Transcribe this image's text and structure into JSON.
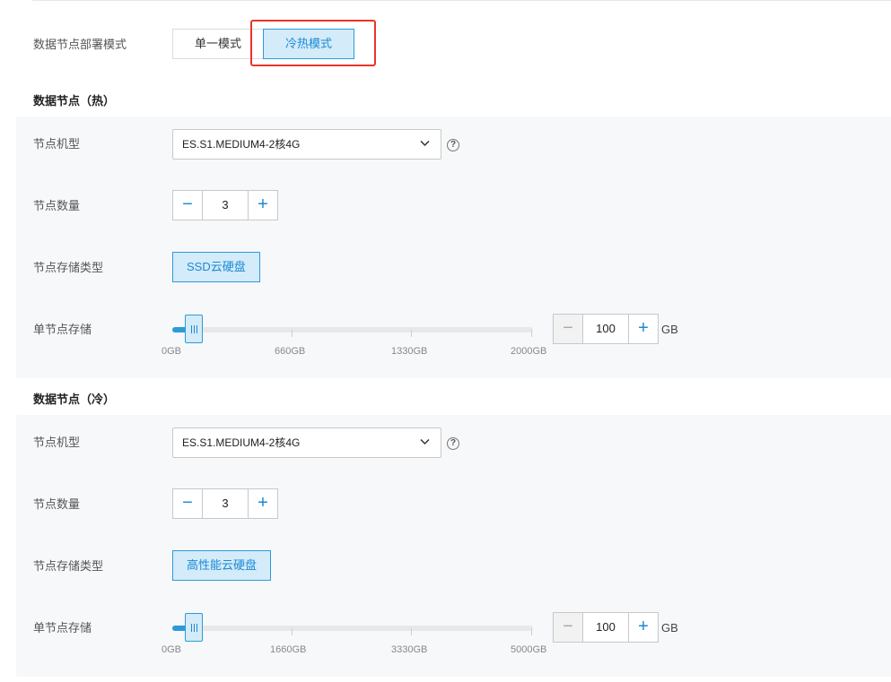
{
  "deploy_mode": {
    "label": "数据节点部署模式",
    "options": [
      "单一模式",
      "冷热模式"
    ],
    "selected": "冷热模式"
  },
  "hot": {
    "title": "数据节点（热）",
    "model_label": "节点机型",
    "model_value": "ES.S1.MEDIUM4-2核4G",
    "count_label": "节点数量",
    "count_value": "3",
    "storage_type_label": "节点存储类型",
    "storage_type_value": "SSD云硬盘",
    "storage_label": "单节点存储",
    "storage_value": "100",
    "storage_unit": "GB",
    "slider_min": 0,
    "slider_max": 2000,
    "slider_value": 20,
    "ticks": [
      "0GB",
      "660GB",
      "1330GB",
      "2000GB"
    ]
  },
  "cold": {
    "title": "数据节点（冷）",
    "model_label": "节点机型",
    "model_value": "ES.S1.MEDIUM4-2核4G",
    "count_label": "节点数量",
    "count_value": "3",
    "storage_type_label": "节点存储类型",
    "storage_type_value": "高性能云硬盘",
    "storage_label": "单节点存储",
    "storage_value": "100",
    "storage_unit": "GB",
    "slider_min": 0,
    "slider_max": 5000,
    "slider_value": 20,
    "ticks": [
      "0GB",
      "1660GB",
      "3330GB",
      "5000GB"
    ]
  },
  "icons": {
    "help": "help-circle-icon",
    "dropdown": "chevron-down-icon",
    "minus": "minus-icon",
    "plus": "plus-icon"
  },
  "colors": {
    "accent": "#2d9bd8",
    "accent_text": "#1a8ad3",
    "highlight": "#e8352a",
    "panel_bg": "#f6f8fa"
  }
}
